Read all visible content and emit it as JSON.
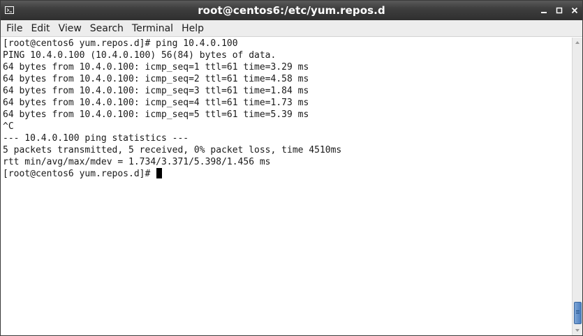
{
  "window": {
    "title": "root@centos6:/etc/yum.repos.d",
    "icons": {
      "app": "terminal-icon",
      "minimize": "minimize-icon",
      "maximize": "maximize-icon",
      "close": "close-icon"
    }
  },
  "menu": {
    "items": [
      "File",
      "Edit",
      "View",
      "Search",
      "Terminal",
      "Help"
    ]
  },
  "terminal": {
    "lines": [
      "[root@centos6 yum.repos.d]# ping 10.4.0.100",
      "PING 10.4.0.100 (10.4.0.100) 56(84) bytes of data.",
      "64 bytes from 10.4.0.100: icmp_seq=1 ttl=61 time=3.29 ms",
      "64 bytes from 10.4.0.100: icmp_seq=2 ttl=61 time=4.58 ms",
      "64 bytes from 10.4.0.100: icmp_seq=3 ttl=61 time=1.84 ms",
      "64 bytes from 10.4.0.100: icmp_seq=4 ttl=61 time=1.73 ms",
      "64 bytes from 10.4.0.100: icmp_seq=5 ttl=61 time=5.39 ms",
      "^C",
      "--- 10.4.0.100 ping statistics ---",
      "5 packets transmitted, 5 received, 0% packet loss, time 4510ms",
      "rtt min/avg/max/mdev = 1.734/3.371/5.398/1.456 ms"
    ],
    "prompt": "[root@centos6 yum.repos.d]# "
  },
  "colors": {
    "titlebar": "#3e3e3e",
    "menubar": "#ededed",
    "terminal_bg": "#ffffff",
    "terminal_fg": "#1a1a1a",
    "scroll_thumb": "#4d7fc0"
  }
}
